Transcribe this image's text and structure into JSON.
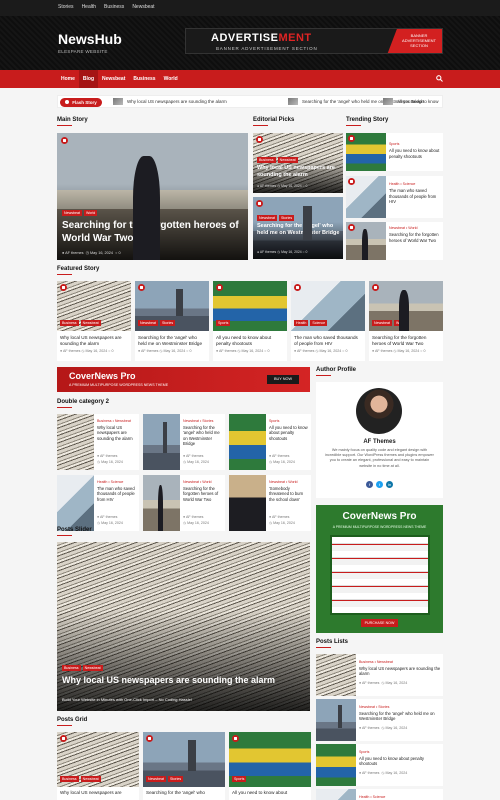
{
  "topbar": {
    "links": [
      "Stories",
      "Health",
      "Business",
      "Newsbeat"
    ]
  },
  "brand": {
    "name": "NewsHub",
    "tagline": "ELESPARE WEBSITE"
  },
  "advertisement": {
    "headline_a": "ADVERTISE",
    "headline_b": "MENT",
    "sub": "BANNER ADVERTISEMENT SECTION",
    "side_text": "BANNER ADVERTISEMENT SECTION"
  },
  "nav": {
    "items": [
      "Home",
      "Blog",
      "Newsbeat",
      "Business",
      "World"
    ],
    "active": "Blog"
  },
  "flash": {
    "label": "Flash Story",
    "items": [
      "Why local US newspapers are sounding the alarm",
      "Searching for the 'angel' who held me on Westminster Bridge",
      "All you need to know"
    ]
  },
  "sections": {
    "main_story": "Main Story",
    "editorial_picks": "Editorial Picks",
    "trending_story": "Trending Story",
    "featured_story": "Featured Story",
    "double_category": "Double category 2",
    "author_profile": "Author Profile",
    "posts_slider": "Posts Slider",
    "posts_lists": "Posts Lists",
    "posts_grid": "Posts Grid"
  },
  "main_story": {
    "tags": [
      "Newsbeat",
      "World"
    ],
    "title": "Searching for the forgotten heroes of World War Two",
    "author": "AF themes",
    "date": "May 16, 2024",
    "comments": "0"
  },
  "editorial": [
    {
      "tags": [
        "Business",
        "Newsbeat"
      ],
      "title": "Why local US newspapers are sounding the alarm",
      "author": "AF themes",
      "date": "May 16, 2024",
      "comments": "0"
    },
    {
      "tags": [
        "Newsbeat",
        "Stories"
      ],
      "title": "Searching for the 'angel' who held me on Westminster Bridge",
      "author": "AF themes",
      "date": "May 16, 2024",
      "comments": "0"
    }
  ],
  "trending": [
    {
      "tags": "Sports",
      "title": "All you need to know about penalty shootouts"
    },
    {
      "tags": "Health • Science",
      "title": "The man who saved thousands of people from HIV"
    },
    {
      "tags": "Newsbeat • World",
      "title": "Searching for the forgotten heroes of World War Two"
    }
  ],
  "featured": [
    {
      "tags": [
        "Business",
        "Newsbeat"
      ],
      "title": "Why local US newspapers are sounding the alarm",
      "author": "AF themes",
      "date": "May 16, 2024",
      "comments": "0"
    },
    {
      "tags": [
        "Newsbeat",
        "Stories"
      ],
      "title": "Searching for the 'angel' who held me on Westminster Bridge",
      "author": "AF themes",
      "date": "May 16, 2024",
      "comments": "0"
    },
    {
      "tags": [
        "Sports"
      ],
      "title": "All you need to know about penalty shootouts",
      "author": "AF themes",
      "date": "May 16, 2024",
      "comments": "0"
    },
    {
      "tags": [
        "Health",
        "Science"
      ],
      "title": "The man who saved thousands of people from HIV",
      "author": "AF themes",
      "date": "May 16, 2024",
      "comments": "0"
    },
    {
      "tags": [
        "Newsbeat",
        "World"
      ],
      "title": "Searching for the forgotten heroes of World War Two",
      "author": "AF themes",
      "date": "May 16, 2024",
      "comments": "0"
    }
  ],
  "promo_small": {
    "title": "CoverNews Pro",
    "sub": "A PREMIUM MULTIPURPOSE WORDPRESS NEWS THEME",
    "button": "BUY NOW"
  },
  "double_category": [
    {
      "tags": "Business • Newsbeat",
      "title": "Why local US newspapers are sounding the alarm",
      "author": "AF themes",
      "date": "May 16, 2024"
    },
    {
      "tags": "Newsbeat • Stories",
      "title": "Searching for the 'angel' who held me on Westminster Bridge",
      "author": "AF themes",
      "date": "May 16, 2024"
    },
    {
      "tags": "Sports",
      "title": "All you need to know about penalty shootouts",
      "author": "AF themes",
      "date": "May 16, 2024"
    },
    {
      "tags": "Health • Science",
      "title": "The man who saved thousands of people from HIV",
      "author": "AF themes",
      "date": "May 16, 2024"
    },
    {
      "tags": "Newsbeat • World",
      "title": "Searching for the forgotten heroes of World War Two",
      "author": "AF themes",
      "date": "May 16, 2024"
    },
    {
      "tags": "Newsbeat • World",
      "title": "'Somebody threatened to burn the school down'",
      "author": "AF themes",
      "date": "May 16, 2024"
    }
  ],
  "author": {
    "name": "AF Themes",
    "bio": "We mainly focus on quality code and elegant design with incredible support. Our WordPress themes and plugins empower you to create an elegant, professional and easy to maintain website in no time at all."
  },
  "promo_big": {
    "title": "CoverNews Pro",
    "sub": "A PREMIUM MULTIPURPOSE WORDPRESS NEWS THEME",
    "button": "PURCHASE NOW"
  },
  "slider": {
    "tags": [
      "Business",
      "Newsbeat"
    ],
    "title": "Why local US newspapers are sounding the alarm",
    "caption": "Build Your Website in Minutes with One-Click Import – No Coding Hassle!"
  },
  "posts_lists": [
    {
      "tags": "Business • Newsbeat",
      "title": "Why local US newspapers are sounding the alarm",
      "author": "AF themes",
      "date": "May 16, 2024"
    },
    {
      "tags": "Newsbeat • Stories",
      "title": "Searching for the 'angel' who held me on Westminster Bridge",
      "author": "AF themes",
      "date": "May 16, 2024"
    },
    {
      "tags": "Sports",
      "title": "All you need to know about penalty shootouts",
      "author": "AF themes",
      "date": "May 16, 2024"
    },
    {
      "tags": "Health • Science"
    }
  ],
  "posts_grid": [
    {
      "tags": [
        "Business",
        "Newsbeat"
      ],
      "title": "Why local US newspapers are"
    },
    {
      "tags": [
        "Newsbeat",
        "Stories"
      ],
      "title": "Searching for the 'angel' who"
    },
    {
      "tags": [
        "Sports"
      ],
      "title": "All you need to know about"
    }
  ],
  "colors": {
    "accent": "#c81c1c",
    "dark": "#111111"
  }
}
